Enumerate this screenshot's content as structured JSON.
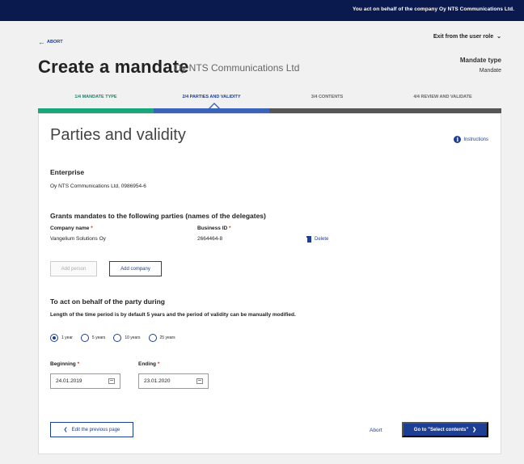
{
  "topbar": {
    "role_note": "You act on behalf of the company Oy NTS Communications Ltd."
  },
  "header": {
    "abort_label": "ABORT",
    "exit_role_label": "Exit from the user role",
    "title": "Create a mandate",
    "subtitle": "Oy NTS Communications Ltd",
    "mandate_type_label": "Mandate type",
    "mandate_type_value": "Mandate"
  },
  "steps": [
    {
      "label": "1/4 MANDATE TYPE",
      "state": "done"
    },
    {
      "label": "2/4 PARTIES AND VALIDITY",
      "state": "active"
    },
    {
      "label": "3/4 CONTENTS",
      "state": "pending"
    },
    {
      "label": "4/4 REVIEW AND VALIDATE",
      "state": "pending"
    }
  ],
  "main": {
    "section_title": "Parties and validity",
    "instructions_label": "Instructions",
    "enterprise": {
      "heading": "Enterprise",
      "value": "Oy NTS Communications Ltd, 0986954-6"
    },
    "delegates": {
      "heading": "Grants mandates to the following parties (names of the delegates)",
      "company_name_label": "Company name",
      "business_id_label": "Business ID",
      "rows": [
        {
          "company_name": "Vangelium Solutions Oy",
          "business_id": "2664464-8",
          "delete_label": "Delete"
        }
      ],
      "add_person_label": "Add person",
      "add_company_label": "Add company"
    },
    "validity": {
      "heading": "To act on behalf of the party during",
      "note": "Length of the time period is by default 5 years and the period of validity can be manually modified.",
      "options": [
        "1 year",
        "5 years",
        "10 years",
        "25 years"
      ],
      "selected_option": "1 year",
      "beginning_label": "Beginning",
      "beginning_value": "24.01.2019",
      "ending_label": "Ending",
      "ending_value": "23.01.2020"
    },
    "footer": {
      "back_label": "Edit the previous page",
      "abort_label": "Abort",
      "next_label": "Go to \"Select contents\""
    }
  },
  "colors": {
    "topbar": "#0a1a4e",
    "primary": "#1c3e94",
    "step_done": "#19a67b",
    "step_active": "#3b63b8",
    "step_pending": "#565656",
    "required": "#c0392b"
  }
}
